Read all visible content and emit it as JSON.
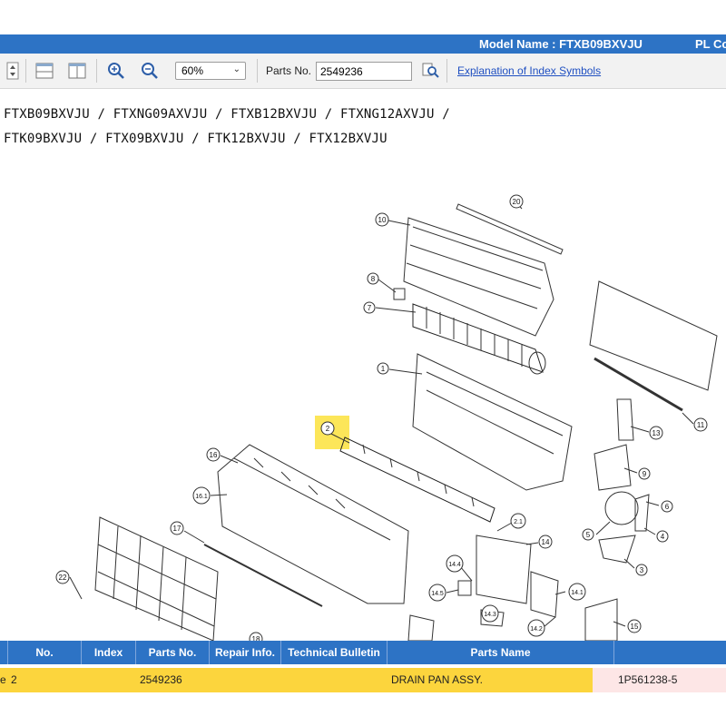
{
  "header": {
    "model_name": "Model Name : FTXB09BXVJU",
    "cut_text": "PL Co"
  },
  "toolbar": {
    "zoom_value": "60%",
    "parts_no_label": "Parts No.",
    "parts_no_value": "2549236",
    "explanation_link": "Explanation of Index Symbols",
    "icons": [
      "scroll-icon",
      "horizontal-split-icon",
      "vertical-split-icon",
      "zoom-in-icon",
      "zoom-out-icon",
      "parts-search-icon"
    ]
  },
  "models": {
    "line1": "FTXB09BXVJU / FTXNG09AXVJU / FTXB12BXVJU / FTXNG12AXVJU /",
    "line2": "FTK09BXVJU / FTX09BXVJU / FTK12BXVJU / FTX12BXVJU"
  },
  "diagram": {
    "callouts": [
      "20",
      "10",
      "8",
      "7",
      "1",
      "2",
      "11",
      "13",
      "16",
      "16.1",
      "9",
      "6",
      "5",
      "4",
      "3",
      "17",
      "2.1",
      "14",
      "14.4",
      "14.5",
      "14.1",
      "14.3",
      "14.2",
      "15",
      "22",
      "18"
    ],
    "selected_callout": "2",
    "highlight_color": "#fce23c"
  },
  "table": {
    "headers": {
      "no": "No.",
      "index": "Index",
      "parts_no": "Parts No.",
      "repair_info": "Repair Info.",
      "technical_bulletin": "Technical Bulletin",
      "parts_name": "Parts Name"
    },
    "rows": [
      {
        "cut_prefix": "e",
        "no": "2",
        "parts_no": "2549236",
        "parts_name": "DRAIN PAN ASSY.",
        "spec": "1P561238-5"
      }
    ]
  },
  "colors": {
    "titlebar": "#2d73c5",
    "row_highlight": "#fcd53d",
    "row_spec_bg": "#fde6e6",
    "link": "#1f4fc1"
  }
}
